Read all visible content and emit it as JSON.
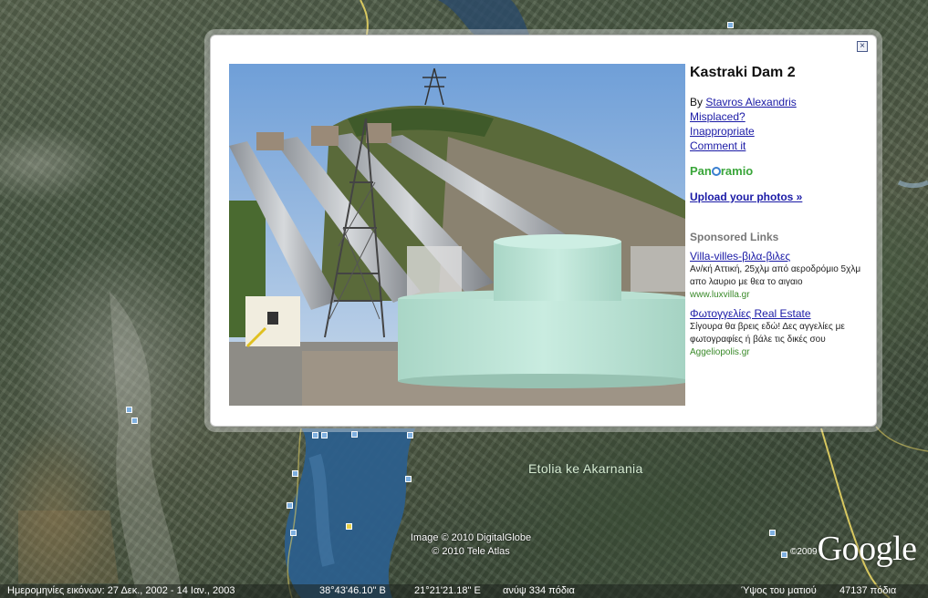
{
  "map": {
    "region_label": "Etolia ke Akarnania",
    "copyright_lines": [
      "Image © 2010 DigitalGlobe",
      "© 2010 Tele Atlas"
    ],
    "google_year": "©2009",
    "google_word": "Google"
  },
  "status_bar": {
    "imagery_dates": "Ημερομηνίες εικόνων: 27 Δεκ., 2002 - 14 Ιαν., 2003",
    "latitude": "38°43'46.10\" Β",
    "longitude": "21°21'21.18\" Ε",
    "elevation": "ανύψ  334 πόδια",
    "eye_altitude_label": "Ύψος του ματιού",
    "eye_altitude_value": "47137 πόδια"
  },
  "balloon": {
    "close_glyph": "×",
    "title": "Kastraki Dam 2",
    "by_prefix": "By",
    "author": "Stavros Alexandris",
    "misplaced": "Misplaced?",
    "inappropriate": "Inappropriate",
    "comment": "Comment it",
    "panoramio_left": "Pan",
    "panoramio_right": "ramio",
    "upload": "Upload your photos »",
    "sponsored_title": "Sponsored Links",
    "ads": [
      {
        "title": "Villa-villes-βιλα-βιλες",
        "desc": "Αν/κή Αττική, 25χλμ από αεροδρόμιο 5χλμ απο λαυριο με θεα το αιγαιο",
        "url": "www.luxvilla.gr"
      },
      {
        "title": "Φωτογγελίες Real Estate",
        "desc": "Σίγουρα θα βρεις εδώ! Δες αγγελίες με φωτογραφίες ή βάλε τις δικές σου",
        "url": "Aggeliopolis.gr"
      }
    ]
  }
}
